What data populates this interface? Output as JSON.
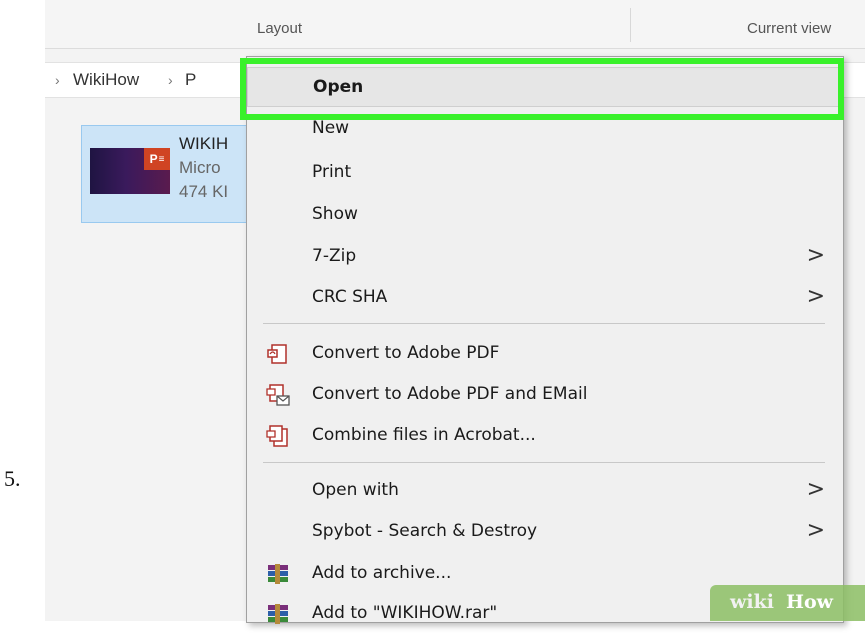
{
  "step_number": "5.",
  "ribbon": {
    "layout_label": "Layout",
    "current_view_label": "Current view"
  },
  "address_bar": {
    "crumbs": [
      "WikiHow",
      "P"
    ],
    "separator": "›"
  },
  "file": {
    "name": "WIKIH",
    "type": "Micro",
    "size": "474 KI",
    "badge": "P"
  },
  "context_menu": {
    "items": [
      {
        "label": "Open",
        "submenu": false,
        "icon": null,
        "highlighted": true
      },
      {
        "label": "New",
        "submenu": false,
        "icon": null
      },
      {
        "label": "Print",
        "submenu": false,
        "icon": null
      },
      {
        "label": "Show",
        "submenu": false,
        "icon": null
      },
      {
        "label": "7-Zip",
        "submenu": true,
        "icon": null
      },
      {
        "label": "CRC SHA",
        "submenu": true,
        "icon": null
      },
      {
        "label": "Convert to Adobe PDF",
        "submenu": false,
        "icon": "adobe-pdf-icon"
      },
      {
        "label": "Convert to Adobe PDF and EMail",
        "submenu": false,
        "icon": "adobe-pdf-email-icon"
      },
      {
        "label": "Combine files in Acrobat...",
        "submenu": false,
        "icon": "acrobat-combine-icon"
      },
      {
        "label": "Open with",
        "submenu": true,
        "icon": null
      },
      {
        "label": "Spybot - Search & Destroy",
        "submenu": true,
        "icon": null
      },
      {
        "label": "Add to archive...",
        "submenu": false,
        "icon": "winrar-icon"
      },
      {
        "label": "Add to \"WIKIHOW.rar\"",
        "submenu": false,
        "icon": "winrar-icon"
      }
    ],
    "submenu_arrow": ">"
  },
  "callout_color": "#39f12b",
  "watermark": {
    "wiki": "wiki",
    "how": "How"
  }
}
